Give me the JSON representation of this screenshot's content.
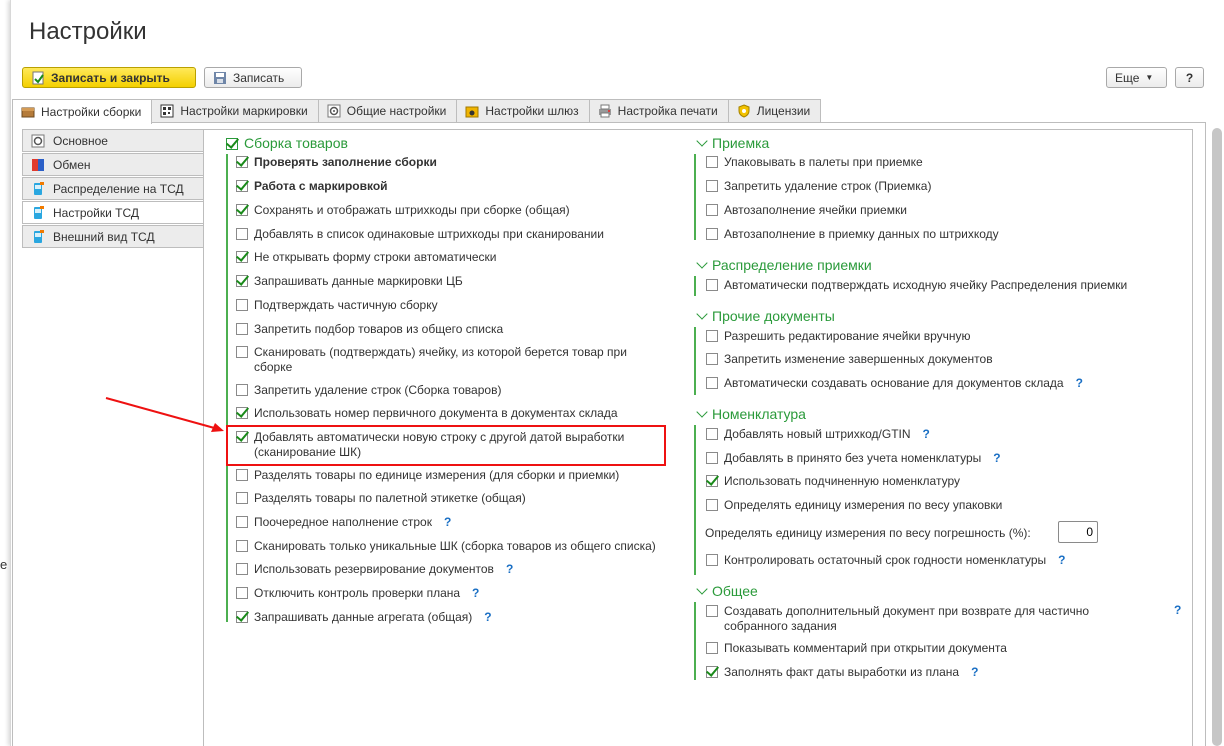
{
  "window": {
    "title": "Настройки"
  },
  "toolbar": {
    "save_close_label": "Записать и закрыть",
    "save_label": "Записать",
    "more_label": "Еще",
    "help_label": "?"
  },
  "tabs": [
    {
      "label": "Настройки сборки",
      "active": true
    },
    {
      "label": "Настройки маркировки"
    },
    {
      "label": "Общие настройки"
    },
    {
      "label": "Настройки шлюз"
    },
    {
      "label": "Настройка печати"
    },
    {
      "label": "Лицензии"
    }
  ],
  "sidebar": {
    "items": [
      {
        "label": "Основное"
      },
      {
        "label": "Обмен"
      },
      {
        "label": "Распределение на ТСД"
      },
      {
        "label": "Настройки ТСД",
        "active": true
      },
      {
        "label": "Внешний вид ТСД"
      }
    ]
  },
  "left_group": {
    "title": "Сборка товаров",
    "items": [
      {
        "label": "Проверять заполнение сборки",
        "checked": true,
        "bold": true
      },
      {
        "label": "Работа с маркировкой",
        "checked": true,
        "bold": true
      },
      {
        "label": "Сохранять  и отображать штрихкоды при сборке (общая)",
        "checked": true
      },
      {
        "label": "Добавлять в список одинаковые штрихкоды при сканировании",
        "checked": false
      },
      {
        "label": "Не открывать форму строки автоматически",
        "checked": true
      },
      {
        "label": "Запрашивать данные маркировки ЦБ",
        "checked": true
      },
      {
        "label": "Подтверждать частичную сборку",
        "checked": false
      },
      {
        "label": "Запретить подбор товаров из общего списка",
        "checked": false
      },
      {
        "label": "Сканировать (подтверждать) ячейку, из которой берется товар при сборке",
        "checked": false
      },
      {
        "label": "Запретить удаление строк (Сборка товаров)",
        "checked": false
      },
      {
        "label": "Использовать номер первичного документа в документах склада",
        "checked": true
      },
      {
        "label": "Добавлять автоматически новую строку с другой датой выработки (сканирование ШК)",
        "checked": true
      },
      {
        "label": "Разделять товары по единице измерения (для сборки и приемки)",
        "checked": false
      },
      {
        "label": "Разделять товары по палетной этикетке (общая)",
        "checked": false
      },
      {
        "label": "Поочередное наполнение строк",
        "checked": false,
        "help": "?"
      },
      {
        "label": "Сканировать только уникальные ШК (сборка товаров из общего списка)",
        "checked": false
      },
      {
        "label": "Использовать резервирование документов",
        "checked": false,
        "help": "?"
      },
      {
        "label": "Отключить контроль проверки плана",
        "checked": false,
        "help": "?"
      },
      {
        "label": "Запрашивать данные агрегата (общая)",
        "checked": true,
        "help": "?"
      }
    ]
  },
  "right_groups": {
    "priemka": {
      "title": "Приемка",
      "items": [
        {
          "label": "Упаковывать в палеты при приемке",
          "checked": false
        },
        {
          "label": "Запретить удаление строк (Приемка)",
          "checked": false
        },
        {
          "label": "Автозаполнение ячейки приемки",
          "checked": false
        },
        {
          "label": "Автозаполнение в приемку данных по штрихкоду",
          "checked": false
        }
      ]
    },
    "raspredelenie": {
      "title": "Распределение приемки",
      "items": [
        {
          "label": "Автоматически подтверждать исходную ячейку Распределения приемки",
          "checked": false
        }
      ]
    },
    "prochie": {
      "title": "Прочие документы",
      "items": [
        {
          "label": "Разрешить редактирование ячейки вручную",
          "checked": false
        },
        {
          "label": "Запретить изменение завершенных документов",
          "checked": false
        },
        {
          "label": "Автоматически создавать основание для документов склада",
          "checked": false,
          "help": "?"
        }
      ]
    },
    "nomenklatura": {
      "title": "Номенклатура",
      "items": [
        {
          "label": "Добавлять новый штрихкод/GTIN",
          "checked": false,
          "help": "?"
        },
        {
          "label": "Добавлять в принято без учета номенклатуры",
          "checked": false,
          "help": "?"
        },
        {
          "label": "Использовать подчиненную номенклатуру",
          "checked": true
        },
        {
          "label": "Определять единицу измерения по весу упаковки",
          "checked": false
        }
      ],
      "tolerance_label": "Определять единицу измерения по весу погрешность (%):",
      "tolerance_value": "0",
      "shelf_life": {
        "label": "Контролировать остаточный срок годности номенклатуры",
        "checked": false,
        "help": "?"
      }
    },
    "obshee": {
      "title": "Общее",
      "items": [
        {
          "label": "Создавать дополнительный документ при возврате для частично собранного задания",
          "checked": false,
          "help": "?"
        },
        {
          "label": "Показывать комментарий при открытии документа",
          "checked": false
        },
        {
          "label": "Заполнять факт даты выработки из плана",
          "checked": true,
          "help": "?"
        }
      ]
    }
  },
  "edge_text": "e"
}
